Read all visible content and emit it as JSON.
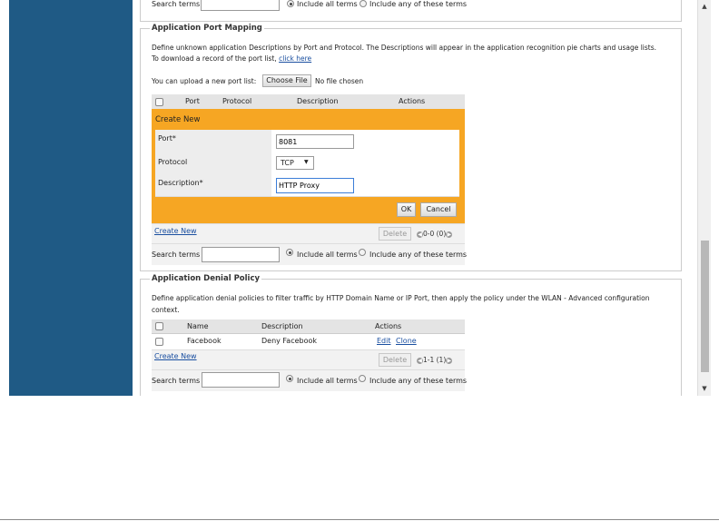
{
  "top_search": {
    "label": "Search terms",
    "value": "",
    "opt_all": "Include all terms",
    "opt_any": "Include any of these terms"
  },
  "port_mapping": {
    "legend": "Application Port Mapping",
    "desc": "Define unknown application Descriptions by Port and Protocol. The Descriptions will appear in the application recognition pie charts and usage lists.",
    "download_text": "To download a record of the port list,",
    "download_link": "click here",
    "upload_label": "You can upload a new port list:",
    "choose_file": "Choose File",
    "no_file": "No file chosen",
    "columns": [
      "Port",
      "Protocol",
      "Description",
      "Actions"
    ],
    "create_new_title": "Create New",
    "form": {
      "port_label": "Port*",
      "port_value": "8081",
      "protocol_label": "Protocol",
      "protocol_value": "TCP",
      "description_label": "Description*",
      "description_value": "HTTP Proxy"
    },
    "ok": "OK",
    "cancel": "Cancel",
    "create_new_link": "Create New",
    "delete": "Delete",
    "pager": "0-0 (0)",
    "search": {
      "label": "Search terms",
      "value": "",
      "opt_all": "Include all terms",
      "opt_any": "Include any of these terms"
    }
  },
  "denial": {
    "legend": "Application Denial Policy",
    "desc_line1": "Define application denial policies to filter traffic by HTTP Domain Name or IP Port, then apply the policy under the WLAN - Advanced configuration",
    "desc_line2": "context.",
    "columns": [
      "Name",
      "Description",
      "Actions"
    ],
    "rows": [
      {
        "name": "Facebook",
        "description": "Deny Facebook",
        "edit": "Edit",
        "clone": "Clone"
      }
    ],
    "create_new_link": "Create New",
    "delete": "Delete",
    "pager": "1-1 (1)",
    "search": {
      "label": "Search terms",
      "value": "",
      "opt_all": "Include all terms",
      "opt_any": "Include any of these terms"
    }
  }
}
